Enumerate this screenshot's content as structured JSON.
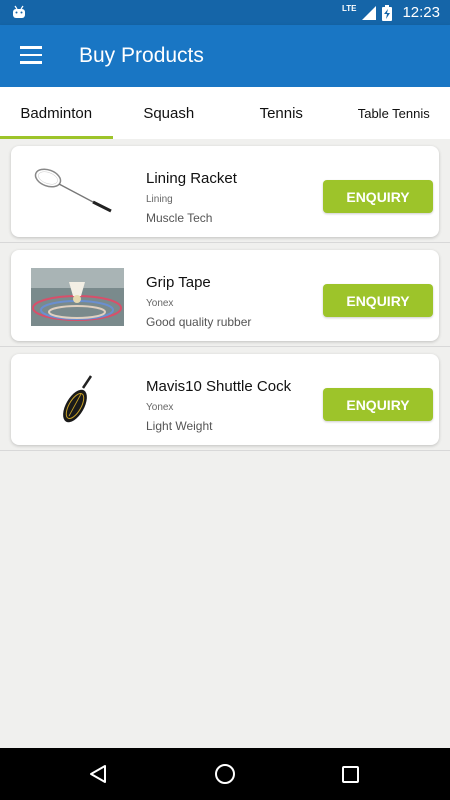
{
  "status_bar": {
    "network": "LTE",
    "time": "12:23"
  },
  "app_bar": {
    "title": "Buy Products"
  },
  "tabs": [
    {
      "label": "Badminton",
      "active": true
    },
    {
      "label": "Squash",
      "active": false
    },
    {
      "label": "Tennis",
      "active": false
    },
    {
      "label": "Table Tennis",
      "active": false
    }
  ],
  "products": [
    {
      "name": "Lining Racket",
      "brand": "Lining",
      "description": "Muscle Tech",
      "button": "ENQUIRY"
    },
    {
      "name": "Grip Tape",
      "brand": "Yonex",
      "description": "Good quality rubber",
      "button": "ENQUIRY"
    },
    {
      "name": "Mavis10 Shuttle Cock",
      "brand": "Yonex",
      "description": "Light Weight",
      "button": "ENQUIRY"
    }
  ],
  "colors": {
    "primary": "#1976c4",
    "status": "#1565a8",
    "accent": "#9dc42a"
  }
}
